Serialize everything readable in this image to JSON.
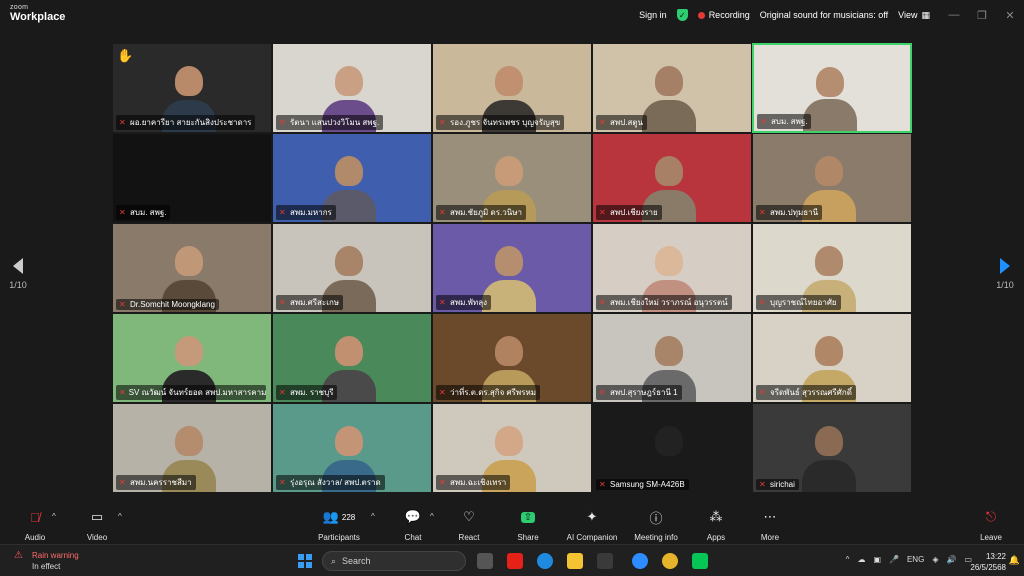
{
  "title_bar": {
    "brand_small": "zoom",
    "brand_big": "Workplace",
    "sign_in": "Sign in",
    "recording": "Recording",
    "original_sound": "Original sound for musicians: off",
    "view": "View"
  },
  "pager": {
    "left_label": "1/10",
    "right_label": "1/10"
  },
  "participants": [
    {
      "name": "ผอ.ยาคารียา สายะกันสิงประชาดาร",
      "raised_hand": true,
      "bg": "#2a2a2a",
      "skin": "#b88a6a",
      "body": "#2d3a4a"
    },
    {
      "name": "รัตนา แสนปวงวิโมน สพฐ.",
      "bg": "#d9d6cf",
      "skin": "#caa084",
      "body": "#6a4d8a"
    },
    {
      "name": "รอง.ภูชร จันทรเพชร บุญจรัญสุข",
      "bg": "#c9b89a",
      "skin": "#c09070",
      "body": "#3d3a35"
    },
    {
      "name": "สพป.สตูน",
      "bg": "#cfc2a8",
      "skin": "#a58066",
      "body": "#7a6a58"
    },
    {
      "name": "สบม. สพฐ.",
      "bg": "#e2e0d8",
      "skin": "#b58e72",
      "body": "#8a7a6a",
      "active": true
    },
    {
      "name": "สบม. สพฐ.",
      "bg": "#121212",
      "skin": "#121212",
      "body": "#121212"
    },
    {
      "name": "สพม.มหากร",
      "bg": "#3f5fae",
      "skin": "#b08a6a",
      "body": "#5a5a6a"
    },
    {
      "name": "สพม.ชัยภูมิ ดร.วนิษา",
      "bg": "#9a8f7a",
      "skin": "#c79a78",
      "body": "#b59a5a"
    },
    {
      "name": "สพป.เชียงราย",
      "bg": "#b9353d",
      "skin": "#a88066",
      "body": "#8a7a68"
    },
    {
      "name": "สพม.ปทุมธานี",
      "bg": "#8a7b6b",
      "skin": "#b08868",
      "body": "#c7a060"
    },
    {
      "name": "Dr.Somchit Moongklang",
      "bg": "#8a7a6a",
      "skin": "#c09878",
      "body": "#5a4a3a"
    },
    {
      "name": "สพม.ศรีสะเกษ",
      "bg": "#c9c4bb",
      "skin": "#a88468",
      "body": "#7a6a5a"
    },
    {
      "name": "สพม.พัทลุง",
      "bg": "#6b5aa8",
      "skin": "#b58e70",
      "body": "#c9b27a"
    },
    {
      "name": "สพม.เชียงใหม่ วราภรณ์ อนุวรรตน์",
      "bg": "#d6cec4",
      "skin": "#dcb89a",
      "body": "#c29080"
    },
    {
      "name": "บุญราชณ์ไทยอาศัย",
      "bg": "#ddd8cc",
      "skin": "#b08a6c",
      "body": "#c7b07a"
    },
    {
      "name": "SV ณวัฒน์ จันทร์ยอด สพป.มหาสารคาม เขต",
      "bg": "#7fb87a",
      "skin": "#c59a7a",
      "body": "#2a2a2a"
    },
    {
      "name": "สพม. ราชบุรี",
      "bg": "#4a8a5a",
      "skin": "#c09070",
      "body": "#4a4a4a"
    },
    {
      "name": "ว่าที่ร.ต.ดร.สุกิจ ศรีพรหม",
      "bg": "#6a4a2a",
      "skin": "#b08260",
      "body": "#b89a5a"
    },
    {
      "name": "สพป.สุราษฎร์ธานี 1",
      "bg": "#c8c4be",
      "skin": "#a88468",
      "body": "#6a6a6a"
    },
    {
      "name": "จรีดพันธ์ สุวรรณศรีศักดิ์",
      "bg": "#d8d2c6",
      "skin": "#b08868",
      "body": "#c4a866"
    },
    {
      "name": "สพม.นครราชสีมา",
      "bg": "#b7b2a8",
      "skin": "#b48c6e",
      "body": "#9a8a5a"
    },
    {
      "name": "รุ่งอรุณ สังวาล/ สพป.ตราด",
      "bg": "#5a9a8a",
      "skin": "#c49476",
      "body": "#3a6a8a"
    },
    {
      "name": "สพม.ฉะเชิงเทรา",
      "bg": "#cfc8bc",
      "skin": "#d2a888",
      "body": "#c9a45a"
    },
    {
      "name": "Samsung SM-A426B",
      "bg": "#1a1a1a",
      "skin": "#222",
      "body": "#1a1a1a"
    },
    {
      "name": "sirichai",
      "bg": "#3a3a3a",
      "skin": "#8a6a52",
      "body": "#2a2a2a"
    }
  ],
  "toolbar": {
    "audio": "Audio",
    "video": "Video",
    "participants": "Participants",
    "participants_count": "228",
    "chat": "Chat",
    "react": "React",
    "share": "Share",
    "ai_companion": "AI Companion",
    "meeting_info": "Meeting info",
    "apps": "Apps",
    "more": "More",
    "leave": "Leave"
  },
  "taskbar": {
    "weather_title": "Rain warning",
    "weather_sub": "In effect",
    "search_placeholder": "Search",
    "lang": "ENG",
    "time": "13:22",
    "date": "26/5/2568"
  }
}
